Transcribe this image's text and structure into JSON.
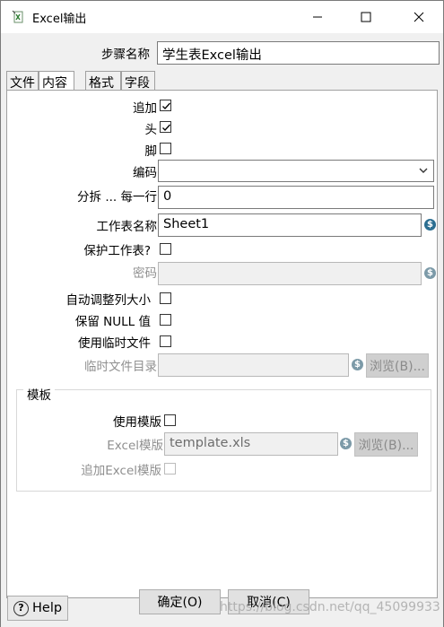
{
  "window": {
    "title": "Excel输出",
    "minimize_glyph": "—",
    "maximize_glyph": "☐",
    "close_glyph": "✕"
  },
  "step": {
    "label": "步骤名称",
    "value": "学生表Excel输出"
  },
  "tabs": [
    {
      "label": "文件",
      "active": false
    },
    {
      "label": "内容",
      "active": true
    },
    {
      "label": "格式",
      "active": false
    },
    {
      "label": "字段",
      "active": false
    }
  ],
  "content": {
    "append": {
      "label": "追加",
      "checked": true
    },
    "header": {
      "label": "头",
      "checked": true
    },
    "footer": {
      "label": "脚",
      "checked": false
    },
    "encoding": {
      "label": "编码",
      "value": ""
    },
    "split_every": {
      "label": "分拆 ... 每一行",
      "value": "0"
    },
    "sheet_name": {
      "label": "工作表名称",
      "value": "Sheet1"
    },
    "protect_sheet": {
      "label": "保护工作表?",
      "checked": false
    },
    "password": {
      "label": "密码",
      "value": ""
    },
    "autosize": {
      "label": "自动调整列大小",
      "checked": false
    },
    "retain_null": {
      "label": "保留 NULL 值",
      "checked": false
    },
    "use_temp": {
      "label": "使用临时文件",
      "checked": false
    },
    "temp_dir": {
      "label": "临时文件目录",
      "value": "",
      "browse": "浏览(B)..."
    }
  },
  "template": {
    "group_title": "模板",
    "use_template": {
      "label": "使用模版",
      "checked": false
    },
    "excel_template": {
      "label": "Excel模版",
      "value": "template.xls",
      "browse": "浏览(B)..."
    },
    "append_template": {
      "label": "追加Excel模版",
      "checked": false
    }
  },
  "footer": {
    "help": "Help",
    "ok": "确定(O)",
    "cancel": "取消(C)"
  },
  "watermark": "https://blog.csdn.net/qq_45099933",
  "colors": {
    "variable_icon": "#2b6e91",
    "panel_bg": "#ffffff",
    "dialog_bg": "#f0f0f0"
  }
}
